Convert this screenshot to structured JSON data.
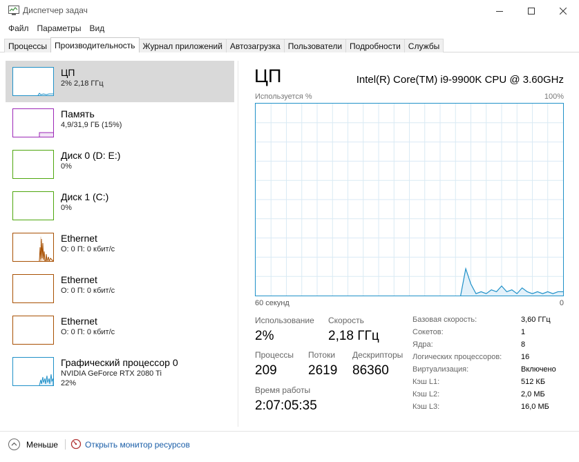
{
  "window": {
    "title": "Диспетчер задач",
    "min_icon": "minimize-icon",
    "max_icon": "maximize-icon",
    "close_icon": "close-icon"
  },
  "menu": [
    "Файл",
    "Параметры",
    "Вид"
  ],
  "tabs": [
    {
      "label": "Процессы",
      "active": false
    },
    {
      "label": "Производительность",
      "active": true
    },
    {
      "label": "Журнал приложений",
      "active": false
    },
    {
      "label": "Автозагрузка",
      "active": false
    },
    {
      "label": "Пользователи",
      "active": false
    },
    {
      "label": "Подробности",
      "active": false
    },
    {
      "label": "Службы",
      "active": false
    }
  ],
  "resources": [
    {
      "name": "ЦП",
      "line1": "2% 2,18 ГГц",
      "line2": "",
      "color": "#1e90c8",
      "selected": true
    },
    {
      "name": "Память",
      "line1": "4,9/31,9 ГБ (15%)",
      "line2": "",
      "color": "#9b26b6",
      "selected": false
    },
    {
      "name": "Диск 0 (D: E:)",
      "line1": "0%",
      "line2": "",
      "color": "#4da60c",
      "selected": false
    },
    {
      "name": "Диск 1 (C:)",
      "line1": "0%",
      "line2": "",
      "color": "#4da60c",
      "selected": false
    },
    {
      "name": "Ethernet",
      "line1": "О: 0 П: 0 кбит/с",
      "line2": "",
      "color": "#a74f01",
      "selected": false
    },
    {
      "name": "Ethernet",
      "line1": "О: 0 П: 0 кбит/с",
      "line2": "",
      "color": "#a74f01",
      "selected": false
    },
    {
      "name": "Ethernet",
      "line1": "О: 0 П: 0 кбит/с",
      "line2": "",
      "color": "#a74f01",
      "selected": false
    },
    {
      "name": "Графический процессор 0",
      "line1": "NVIDIA GeForce RTX 2080 Ti",
      "line2": "22%",
      "color": "#1e90c8",
      "selected": false
    }
  ],
  "cpu": {
    "heading": "ЦП",
    "model": "Intel(R) Core(TM) i9-9900K CPU @ 3.60GHz",
    "graph_label_left": "Используется %",
    "graph_label_right": "100%",
    "axis_left": "60 секунд",
    "axis_right": "0",
    "usage_label": "Использование",
    "usage_value": "2%",
    "speed_label": "Скорость",
    "speed_value": "2,18 ГГц",
    "processes_label": "Процессы",
    "processes_value": "209",
    "threads_label": "Потоки",
    "threads_value": "2619",
    "handles_label": "Дескрипторы",
    "handles_value": "86360",
    "uptime_label": "Время работы",
    "uptime_value": "2:07:05:35"
  },
  "cpu_details": [
    {
      "key": "Базовая скорость:",
      "value": "3,60 ГГц"
    },
    {
      "key": "Сокетов:",
      "value": "1"
    },
    {
      "key": "Ядра:",
      "value": "8"
    },
    {
      "key": "Логических процессоров:",
      "value": "16"
    },
    {
      "key": "Виртуализация:",
      "value": "Включено"
    },
    {
      "key": "Кэш L1:",
      "value": "512 КБ"
    },
    {
      "key": "Кэш L2:",
      "value": "2,0 МБ"
    },
    {
      "key": "Кэш L3:",
      "value": "16,0 МБ"
    }
  ],
  "chart_data": {
    "type": "area",
    "xlabel": "60 секунд",
    "ylabel": "Используется %",
    "ylim": [
      0,
      100
    ],
    "x": [
      60,
      59,
      58,
      57,
      56,
      55,
      54,
      53,
      52,
      51,
      50,
      49,
      48,
      47,
      46,
      45,
      44,
      43,
      42,
      41,
      40,
      39,
      38,
      37,
      36,
      35,
      34,
      33,
      32,
      31,
      30,
      29,
      28,
      27,
      26,
      25,
      24,
      23,
      22,
      21,
      20,
      19,
      18,
      17,
      16,
      15,
      14,
      13,
      12,
      11,
      10,
      9,
      8,
      7,
      6,
      5,
      4,
      3,
      2,
      1,
      0
    ],
    "values": [
      null,
      null,
      null,
      null,
      null,
      null,
      null,
      null,
      null,
      null,
      null,
      null,
      null,
      null,
      null,
      null,
      null,
      null,
      null,
      null,
      null,
      null,
      null,
      null,
      null,
      null,
      null,
      null,
      null,
      null,
      null,
      null,
      null,
      null,
      null,
      null,
      null,
      null,
      null,
      null,
      0,
      14,
      6,
      1,
      2,
      1,
      3,
      2,
      5,
      2,
      3,
      1,
      4,
      2,
      1,
      2,
      1,
      2,
      1,
      2,
      2
    ]
  },
  "footer": {
    "less_label": "Меньше",
    "less_icon": "chevron-up-circle-icon",
    "monitor_label": "Открыть монитор ресурсов",
    "monitor_icon": "resource-monitor-icon"
  }
}
